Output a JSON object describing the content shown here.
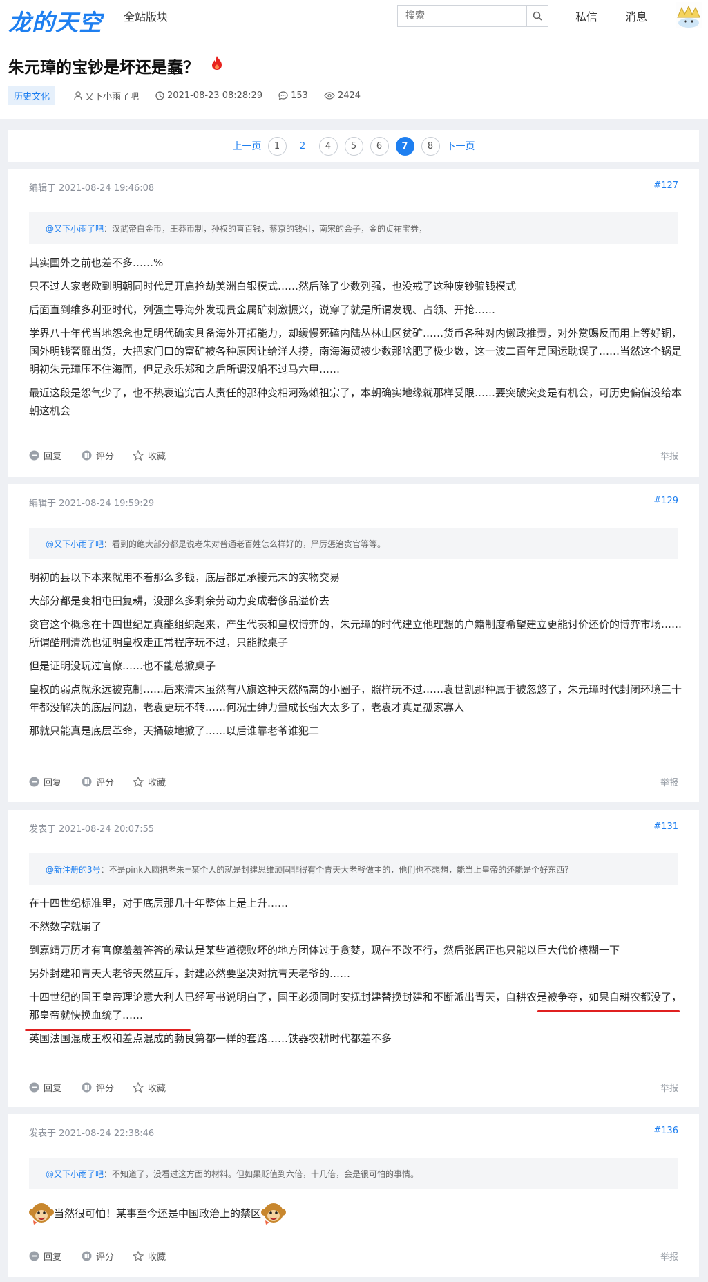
{
  "site": {
    "logo_text": "龙的天空",
    "nav_label": "全站版块",
    "search_placeholder": "搜索",
    "messages_label": "私信",
    "notices_label": "消息"
  },
  "thread": {
    "title": "朱元璋的宝钞是坏还是蠢？",
    "tag": "历史文化",
    "author": "又下小雨了吧",
    "datetime": "2021-08-23 08:28:29",
    "comments": "153",
    "views": "2424"
  },
  "pager": {
    "prev": "上一页",
    "pages": [
      "1",
      "2",
      "4",
      "5",
      "6",
      "7",
      "8"
    ],
    "next": "下一页"
  },
  "actions": {
    "reply": "回复",
    "rate": "评分",
    "fav": "收藏",
    "report": "举报"
  },
  "colors": {
    "accent": "#1e7ff0",
    "underline": "#e02020"
  },
  "posts": [
    {
      "meta": "编辑于 2021-08-24 19:46:08",
      "num": "#127",
      "quote_user": "@又下小雨了吧",
      "quote_text": "：汉武帝白金币，王莽币制，孙权的直百钱，蔡京的钱引，南宋的会子，金的贞祐宝券，",
      "lines": [
        "其实国外之前也差不多……%",
        "只不过人家老欧到明朝同时代是开启抢劫美洲白银模式……然后除了少数列强，也没戒了这种废钞骗钱模式",
        "后面直到维多利亚时代，列强主导海外发现贵金属矿刺激振兴，说穿了就是所谓发现、占领、开抢……",
        "学界八十年代当地怨念也是明代确实具备海外开拓能力，却缓慢死磕内陆丛林山区贫矿……货币各种对内懒政推责，对外赏赐反而用上等好铜，国外明钱奢靡出货，大把家门口的富矿被各种原因让给洋人捞，南海海贸被少数那啥肥了极少数，这一波二百年是国运耽误了……当然这个锅是明初朱元璋压不住海面，但是永乐郑和之后所谓汉船不过马六甲……",
        "最近这段是怨气少了，也不热衷追究古人责任的那种变相河殇赖祖宗了，本朝确实地缘就那样受限……要突破突变是有机会，可历史偏偏没给本朝这机会"
      ]
    },
    {
      "meta": "编辑于 2021-08-24 19:59:29",
      "num": "#129",
      "quote_user": "@又下小雨了吧",
      "quote_text": "：看到的绝大部分都是说老朱对普通老百姓怎么样好的，严厉惩治贪官等等。",
      "lines": [
        "明初的县以下本来就用不着那么多钱，底层都是承接元末的实物交易",
        "大部分都是变相屯田复耕，没那么多剩余劳动力变成奢侈品溢价去",
        "贪官这个概念在十四世纪是真能组织起来，产生代表和皇权博弈的，朱元璋的时代建立他理想的户籍制度希望建立更能讨价还价的博弈市场……所谓酷刑清洗也证明皇权走正常程序玩不过，只能掀桌子",
        "但是证明没玩过官僚……也不能总掀桌子",
        "皇权的弱点就永远被克制……后来清末虽然有八旗这种天然隔离的小圈子，照样玩不过……袁世凯那种属于被忽悠了，朱元璋时代封闭环境三十年都没解决的底层问题，老袁更玩不转……何况士绅力量成长强大太多了，老袁才真是孤家寡人",
        "那就只能真是底层革命，天捅破地掀了……以后谁靠老爷谁犯二"
      ]
    },
    {
      "meta": "发表于 2021-08-24 20:07:55",
      "num": "#131",
      "quote_user": "@新注册的3号",
      "quote_text": "：不是pink入脑把老朱=某个人的就是封建思维顽固非得有个青天大老爷做主的，他们也不想想，能当上皇帝的还能是个好东西？",
      "lines": [
        "在十四世纪标准里，对于底层那几十年整体上是上升……",
        "不然数字就崩了",
        "到嘉靖万历才有官僚羞羞答答的承认是某些道德败坏的地方团体过于贪婪，现在不改不行，然后张居正也只能以巨大代价裱糊一下",
        "另外封建和青天大老爷天然互斥，封建必然要坚决对抗青天老爷的……",
        "十四世纪的国王皇帝理论意大利人已经写书说明白了，国王必须同时安抚封建替换封建和不断派出青天，自耕农是被争夺，如果自耕农都没了，那皇帝就快换血统了……",
        "英国法国混成王权和差点混成的勃艮第都一样的套路……铁器农耕时代都差不多"
      ]
    },
    {
      "meta": "发表于 2021-08-24 22:38:46",
      "num": "#136",
      "quote_user": "@又下小雨了吧",
      "quote_text": "：不知道了，没看过这方面的材料。但如果贬值到六倍，十几倍，会是很可怕的事情。",
      "lines": [
        "当然很可怕！某事至今还是中国政治上的禁区"
      ]
    }
  ]
}
